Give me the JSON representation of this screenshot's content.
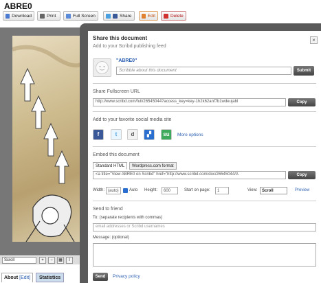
{
  "page": {
    "title": "ABRE0"
  },
  "toolbar": {
    "download": "Download",
    "print": "Print",
    "fullscreen": "Full Screen",
    "share": "Share",
    "edit": "Edit",
    "delete": "Delete"
  },
  "viewer": {
    "scroll_mode": "Scroll"
  },
  "bottom_tabs": {
    "about": "About",
    "edit": "[Edit]",
    "statistics": "Statistics"
  },
  "dialog": {
    "title": "Share this document",
    "subtitle": "Add to your Scribd publishing feed",
    "username": "\"ABRE0\"",
    "scribble_placeholder": "Scribble about this document",
    "submit": "Submit",
    "fullscreen_url_label": "Share Fullscreen URL",
    "fullscreen_url": "http://www.scribd.com/full/26545044?access_key=key-1h2k62anf7b1wdeujabl",
    "copy": "Copy",
    "social_label": "Add to your favorite social media site",
    "social_icons": [
      "facebook-icon",
      "twitter-icon",
      "digg-icon",
      "delicious-icon",
      "stumbleupon-icon"
    ],
    "more_options": "More options",
    "embed_label": "Embed this document",
    "embed_tabs": [
      "Standard HTML",
      "Wordpress.com format"
    ],
    "embed_code": "<a title=\"View ABRE0 on Scribd\" href=\"http://www.scribd.com/doc/26545044/A",
    "width_label": "Width:",
    "width_value": "(auto)",
    "auto_label": "Auto",
    "height_label": "Height:",
    "height_value": "600",
    "start_label": "Start on page:",
    "start_value": "1",
    "view_label": "View:",
    "view_value": "Scroll",
    "preview": "Preview",
    "friend_label": "Send to friend",
    "to_label": "To: (separate recipients with commas)",
    "email_placeholder": "email addresses or Scribd usernames",
    "message_label": "Message: (optional)",
    "send": "Send",
    "privacy": "Privacy policy"
  },
  "colors": {
    "accent_link": "#2a5db0",
    "dialog_frame": "#5a5a5a",
    "pointer_yellow": "#f5e26a"
  }
}
